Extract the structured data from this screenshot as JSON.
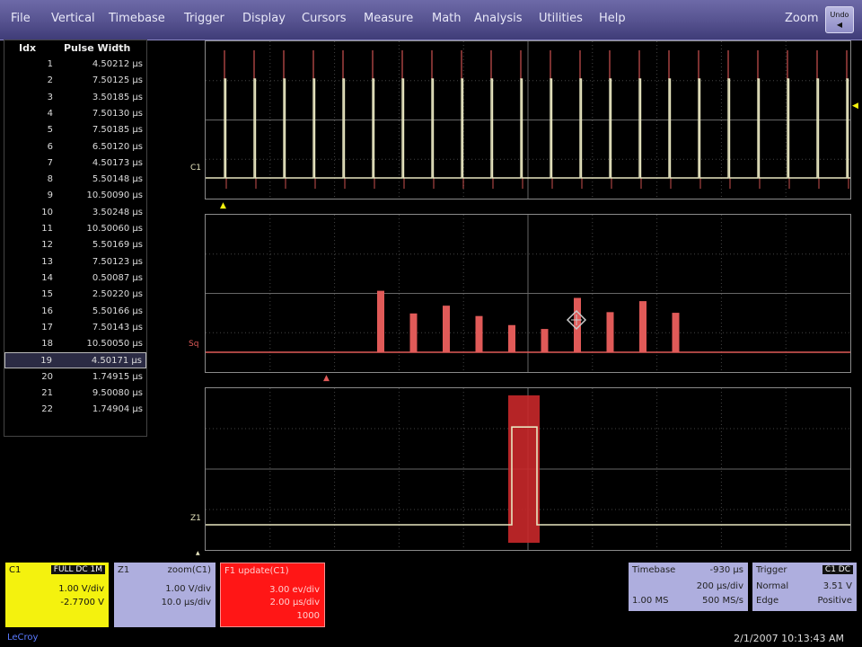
{
  "menu": [
    "File",
    "Vertical",
    "Timebase",
    "Trigger",
    "Display",
    "Cursors",
    "Measure",
    "Math",
    "Analysis",
    "Utilities",
    "Help"
  ],
  "zoom_label": "Zoom",
  "undo": {
    "line1": "Undo",
    "line2": "◀"
  },
  "table": {
    "col_idx": "Idx",
    "col_val": "Pulse Width",
    "selected_index": 19,
    "rows": [
      {
        "i": "1",
        "v": "4.50212 µs"
      },
      {
        "i": "2",
        "v": "7.50125 µs"
      },
      {
        "i": "3",
        "v": "3.50185 µs"
      },
      {
        "i": "4",
        "v": "7.50130 µs"
      },
      {
        "i": "5",
        "v": "7.50185 µs"
      },
      {
        "i": "6",
        "v": "6.50120 µs"
      },
      {
        "i": "7",
        "v": "4.50173 µs"
      },
      {
        "i": "8",
        "v": "5.50148 µs"
      },
      {
        "i": "9",
        "v": "10.50090 µs"
      },
      {
        "i": "10",
        "v": "3.50248 µs"
      },
      {
        "i": "11",
        "v": "10.50060 µs"
      },
      {
        "i": "12",
        "v": "5.50169 µs"
      },
      {
        "i": "13",
        "v": "7.50123 µs"
      },
      {
        "i": "14",
        "v": "0.50087 µs"
      },
      {
        "i": "15",
        "v": "2.50220 µs"
      },
      {
        "i": "16",
        "v": "5.50166 µs"
      },
      {
        "i": "17",
        "v": "7.50143 µs"
      },
      {
        "i": "18",
        "v": "10.50050 µs"
      },
      {
        "i": "19",
        "v": "4.50171 µs"
      },
      {
        "i": "20",
        "v": "1.74915 µs"
      },
      {
        "i": "21",
        "v": "9.50080 µs"
      },
      {
        "i": "22",
        "v": "1.74904 µs"
      }
    ]
  },
  "traces": {
    "c1_label": "C1",
    "sq_label": "Sq",
    "z1_label": "Z1",
    "c1_pulse_count": 22,
    "histogram_bar_heights": [
      0.95,
      0.6,
      0.72,
      0.56,
      0.42,
      0.36,
      0.84,
      0.62,
      0.79,
      0.61
    ],
    "zoom_pulse_level": 0.8
  },
  "descriptors": {
    "c1": {
      "title": "C1",
      "tag": "FULL DC 1M",
      "l1": "1.00 V/div",
      "l2": "-2.7700 V"
    },
    "z1": {
      "title": "Z1",
      "tag": "zoom(C1)",
      "l1": "1.00 V/div",
      "l2": "10.0 µs/div"
    },
    "f1": {
      "title": "F1 update(C1)",
      "l1": "3.00 ev/div",
      "l2": "2.00 µs/div",
      "l3": "1000"
    },
    "timebase": {
      "title": "Timebase",
      "val": "-930 µs",
      "l1": "200 µs/div",
      "l2a": "1.00 MS",
      "l2b": "500 MS/s"
    },
    "trigger": {
      "title": "Trigger",
      "tag": "C1 DC",
      "l1a": "Normal",
      "l1b": "3.51 V",
      "l2a": "Edge",
      "l2b": "Positive"
    }
  },
  "timestamp": "2/1/2007 10:13:43 AM",
  "brand": "LeCroy",
  "colors": {
    "trace_c1": "#e8e6c0",
    "trace_red": "#e05a58",
    "panel_yellow": "#f4f20e",
    "panel_lavender": "#aeaede",
    "panel_red": "#ff1616"
  }
}
